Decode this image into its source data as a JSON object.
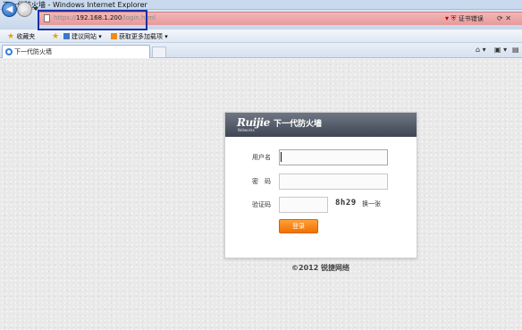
{
  "window": {
    "title": "下一代防火墙 - Windows Internet Explorer"
  },
  "address_bar": {
    "scheme": "https://",
    "host": "192.168.1.200",
    "path": "/login.html",
    "certificate_warning": "证书错误"
  },
  "favorites_bar": {
    "favorites_label": "收藏夹",
    "items": [
      {
        "label": "建议网站 ▾",
        "icon": "page-icon"
      },
      {
        "label": "获取更多加载项 ▾",
        "icon": "addon-icon"
      }
    ]
  },
  "tabs": [
    {
      "label": "下一代防火墙",
      "active": true
    }
  ],
  "login": {
    "logo_text": "Ruijie",
    "logo_subtext": "Networks",
    "title": "下一代防火墙",
    "username_label": "用户名",
    "password_label": "密　码",
    "captcha_label": "验证码",
    "captcha_text": "8h29",
    "refresh_label": "换一张",
    "submit_label": "登录",
    "username_value": "",
    "password_value": "",
    "captcha_value": ""
  },
  "footer": {
    "copyright": "©2012 锐捷网络"
  },
  "colors": {
    "accent_button": "#f07000",
    "header_dark": "#3f4653",
    "address_error": "#e79a9a",
    "highlight_box": "#1b2fa8"
  }
}
